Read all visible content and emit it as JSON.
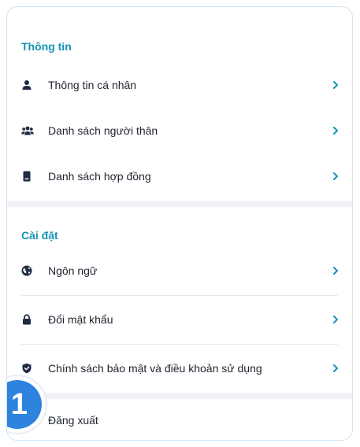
{
  "sections": [
    {
      "title": "Thông tin",
      "items": [
        {
          "label": "Thông tin cá nhân",
          "icon": "person-icon"
        },
        {
          "label": "Danh sách người thân",
          "icon": "people-group-icon"
        },
        {
          "label": "Danh sách hợp đồng",
          "icon": "contract-document-icon"
        }
      ]
    },
    {
      "title": "Cài đặt",
      "items": [
        {
          "label": "Ngôn ngữ",
          "icon": "globe-icon"
        },
        {
          "label": "Đổi mật khẩu",
          "icon": "lock-icon"
        },
        {
          "label": "Chính sách bảo mật và điều khoản sử dụng",
          "icon": "shield-icon"
        }
      ]
    }
  ],
  "logout": {
    "label": "Đăng xuất"
  },
  "step_badge": "1",
  "colors": {
    "accent": "#1593b5",
    "icon": "#1f2a44",
    "chevron": "#1593b5",
    "border": "#cfe3f4",
    "badge": "#2e83df"
  }
}
